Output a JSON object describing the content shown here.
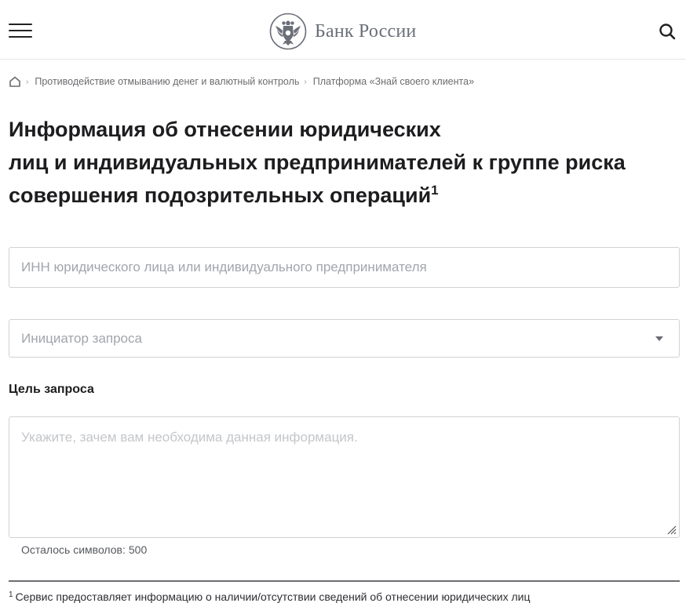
{
  "header": {
    "logo_text": "Банк России",
    "icons": {
      "menu": "hamburger-icon",
      "search": "search-icon",
      "emblem": "double-headed-eagle-emblem"
    }
  },
  "breadcrumb": {
    "home_icon": "home-icon",
    "items": [
      {
        "label": "Противодействие отмыванию денег и валютный контроль"
      },
      {
        "label": "Платформа «Знай своего клиента»"
      }
    ]
  },
  "title": {
    "lines": [
      "Информация об отнесении юридических",
      "лиц и индивидуальных предпринимателей к группе риска",
      "совершения подозрительных операций"
    ],
    "footnote_marker": "1"
  },
  "form": {
    "inn": {
      "placeholder": "ИНН юридического лица или индивидуального предпринимателя",
      "value": ""
    },
    "initiator": {
      "placeholder": "Инициатор запроса",
      "selected": ""
    },
    "purpose": {
      "label": "Цель запроса",
      "placeholder": "Укажите, зачем вам необходима данная информация.",
      "value": "",
      "counter_label": "Осталось символов:",
      "counter_value": "500"
    }
  },
  "footnote": {
    "marker": "1",
    "text": "Сервис предоставляет информацию о наличии/отсутствии сведений об отнесении юридических лиц"
  },
  "colors": {
    "text": "#1d1d1f",
    "muted": "#6c6c70",
    "border": "#cfd2d6",
    "placeholder": "#a2a5ab",
    "logo": "#6b6f78"
  }
}
